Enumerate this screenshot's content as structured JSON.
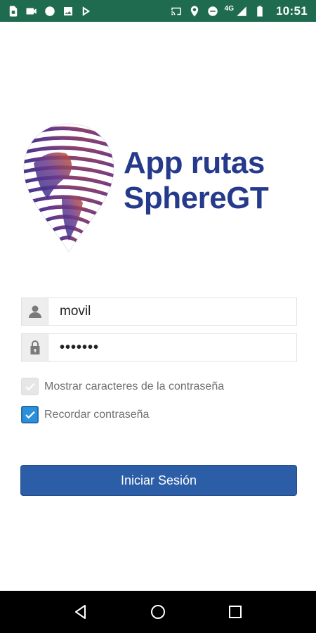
{
  "status_bar": {
    "time": "10:51",
    "network": "4G",
    "left_icons": [
      "sim-card-icon",
      "video-camera-icon",
      "dot-icon",
      "image-icon",
      "play-store-icon"
    ],
    "right_icons": [
      "cast-icon",
      "location-icon",
      "do-not-disturb-icon",
      "signal-icon",
      "battery-icon"
    ]
  },
  "logo": {
    "line1": "App rutas",
    "line2": "SphereGT",
    "brand_color": "#263a8c"
  },
  "form": {
    "username_value": "movil",
    "password_value": "•••••••",
    "show_password_label": "Mostrar caracteres de la contraseña",
    "show_password_checked": false,
    "remember_label": "Recordar contraseña",
    "remember_checked": true,
    "submit_label": "Iniciar Sesión"
  },
  "nav_bar": {
    "items": [
      "back-icon",
      "home-icon",
      "recents-icon"
    ]
  },
  "colors": {
    "status_bar": "#1e6b4f",
    "button": "#2c5ea8",
    "checkbox_checked": "#2a90d9"
  }
}
